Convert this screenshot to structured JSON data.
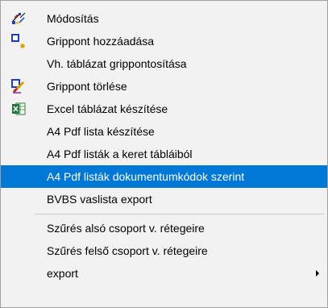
{
  "menu": {
    "items": [
      {
        "label": "Módosítás",
        "icon": "pencil-edit-icon"
      },
      {
        "label": "Grippont hozzáadása",
        "icon": "add-grip-point-icon"
      },
      {
        "label": "Vh. táblázat grippontosítása"
      },
      {
        "label": "Grippont törlése",
        "icon": "delete-grip-point-icon"
      },
      {
        "label": "Excel táblázat készítése",
        "icon": "excel-icon"
      },
      {
        "label": "A4 Pdf lista készítése"
      },
      {
        "label": "A4 Pdf listák a keret tábláiból"
      },
      {
        "label": "A4 Pdf listák dokumentumkódok szerint",
        "highlighted": true
      },
      {
        "label": "BVBS vaslista export"
      },
      {
        "label": "Szűrés alsó csoport v. rétegeire"
      },
      {
        "label": "Szűrés felső csoport v. rétegeire"
      },
      {
        "label": "export",
        "submenu": true
      }
    ]
  },
  "colors": {
    "highlight_background": "#0078d7",
    "highlight_text": "#ffffff",
    "menu_background": "#f2f2f2"
  }
}
